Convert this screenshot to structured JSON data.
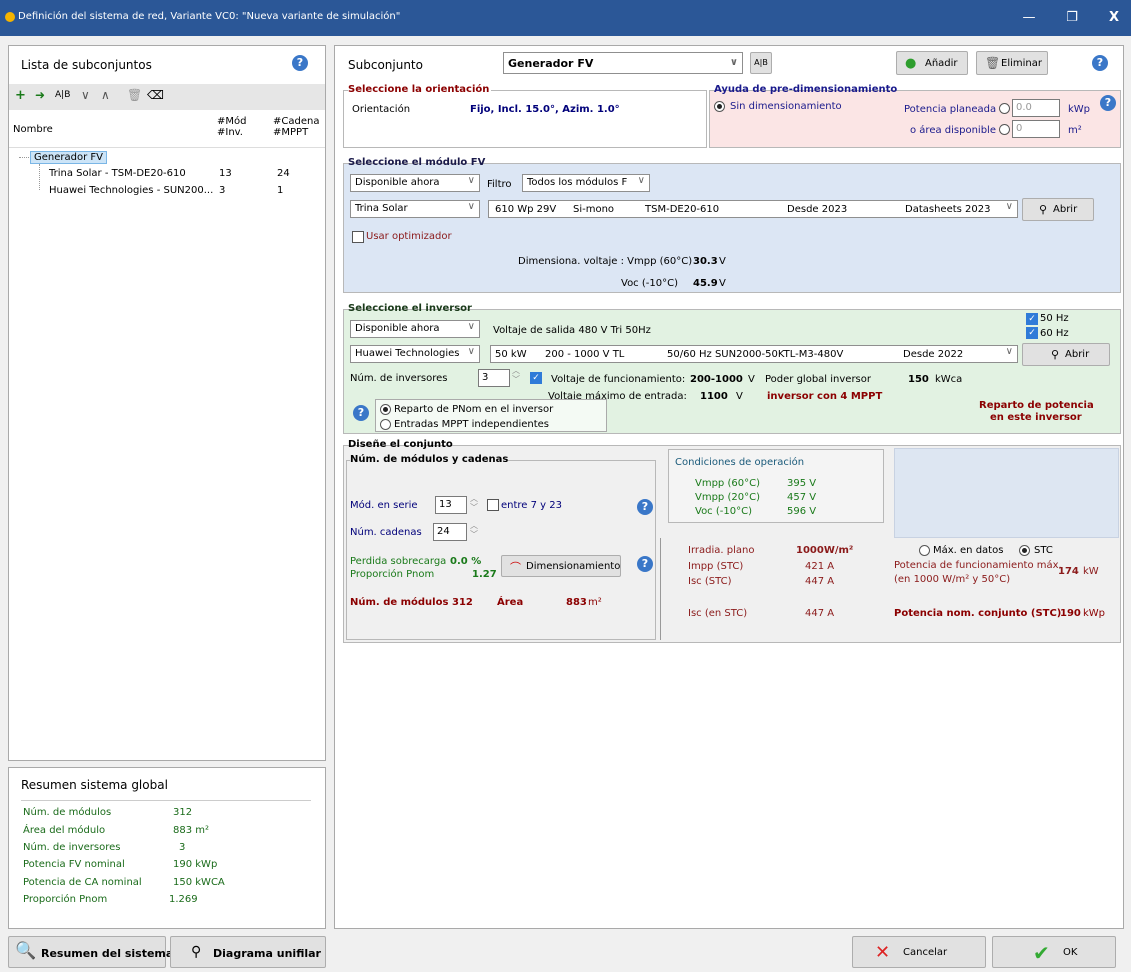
{
  "window": {
    "title": "Definición del sistema de red, Variante VC0:  \"Nueva variante de simulación\"",
    "minimize": "—",
    "restore": "❐",
    "close": "X"
  },
  "left": {
    "title": "Lista de subconjuntos",
    "help": "?",
    "col_nombre": "Nombre",
    "col_mod": "#Mód\n#Inv.",
    "col_mod1": "#Mód",
    "col_mod2": "#Inv.",
    "col_cad1": "#Cadena",
    "col_cad2": "#MPPT",
    "tree": {
      "root": "Generador FV",
      "child1": {
        "name": "Trina Solar - TSM-DE20-610",
        "a": "13",
        "b": "24"
      },
      "child2": {
        "name": "Huawei Technologies - SUN200...",
        "a": "3",
        "b": "1"
      }
    }
  },
  "summary": {
    "title": "Resumen sistema global",
    "rows": [
      {
        "label": "Núm. de módulos",
        "value": "312"
      },
      {
        "label": "Área del módulo",
        "value": "883 m²"
      },
      {
        "label": "Núm. de inversores",
        "value": "3"
      },
      {
        "label": "Potencia FV nominal",
        "value": "190  kWp"
      },
      {
        "label": "Potencia de CA nominal",
        "value": "150  kWCA"
      },
      {
        "label": "Proporción Pnom",
        "value": "1.269"
      }
    ]
  },
  "bottom_left": {
    "resumen": "Resumen del sistema",
    "diagrama": "Diagrama unifilar"
  },
  "top": {
    "subconjunto_label": "Subconjunto",
    "subconjunto_value": "Generador FV",
    "anadir": "Añadir",
    "eliminar": "Eliminar"
  },
  "orient": {
    "title": "Seleccione la orientación",
    "label": "Orientación",
    "value": "Fijo, Incl. 15.0°, Azim. 1.0°"
  },
  "predim": {
    "title": "Ayuda de pre-dimensionamiento",
    "sin": "Sin dimensionamiento",
    "potencia": "Potencia planeada",
    "pot_val": "0.0",
    "pot_unit": "kWp",
    "area": "o área disponible",
    "area_val": "0",
    "area_unit": "m²"
  },
  "module": {
    "title": "Seleccione el módulo FV",
    "disp": "Disponible ahora",
    "filtro": "Filtro",
    "todos": "Todos los módulos F",
    "maker": "Trina Solar",
    "spec1": "610 Wp 29V",
    "spec2": "Si-mono",
    "spec3": "TSM-DE20-610",
    "spec4": "Desde 2023",
    "spec5": "Datasheets 2023",
    "abrir": "Abrir",
    "optim": "Usar optimizador",
    "dim_label": "Dimensiona. voltaje :  Vmpp (60°C)",
    "dim_val": "30.3",
    "dim_unit": "V",
    "voc_label": "Voc (-10°C)",
    "voc_val": "45.9",
    "voc_unit": "V"
  },
  "inverter": {
    "title": "Seleccione el inversor",
    "disp": "Disponible ahora",
    "voltaje": "Voltaje de salida 480 V Tri 50Hz",
    "hz50": "50 Hz",
    "hz60": "60 Hz",
    "maker": "Huawei Technologies",
    "s1": "50 kW",
    "s2": "200 - 1000 V  TL",
    "s3": "50/60 Hz  SUN2000-50KTL-M3-480V",
    "s4": "Desde 2022",
    "abrir": "Abrir",
    "num_label": "Núm. de inversores",
    "num_val": "3",
    "vfunc": "Voltaje de funcionamiento:",
    "vfunc_val": "200-1000",
    "v_unit": "V",
    "poder": "Poder global inversor",
    "poder_val": "150",
    "poder_unit": "kWca",
    "vmax": "Voltaje máximo de entrada:",
    "vmax_val": "1100",
    "vmax_unit": "V",
    "mppt": "inversor con 4 MPPT",
    "opt1": "Reparto de PNom en el inversor",
    "opt2": "Entradas MPPT independientes",
    "reparto1": "Reparto de potencia",
    "reparto2": "en este inversor"
  },
  "array": {
    "title": "Diseñe el conjunto",
    "sub": "Núm. de módulos y cadenas",
    "serie_label": "Mód. en serie",
    "serie_val": "13",
    "entre": "entre 7 y 23",
    "cad_label": "Núm. cadenas",
    "cad_val": "24",
    "perd_label": "Perdida sobrecarga",
    "perd_val": "0.0 %",
    "prop_label": "Proporción Pnom",
    "prop_val": "1.27",
    "dimens": "Dimensionamiento",
    "nmod_label": "Núm. de módulos",
    "nmod_val": "312",
    "area_label": "Área",
    "area_val": "883",
    "area_unit": "m²",
    "cond_title": "Condiciones de operación",
    "c1l": "Vmpp (60°C)",
    "c1v": "395  V",
    "c2l": "Vmpp (20°C)",
    "c2v": "457  V",
    "c3l": "Voc (-10°C)",
    "c3v": "596  V",
    "irr_label": "Irradia. plano",
    "irr_val": "1000W/m²",
    "impp_label": "Impp (STC)",
    "impp_val": "421 A",
    "isc_label": "Isc (STC)",
    "isc_val": "447 A",
    "isc2_label": "Isc (en STC)",
    "isc2_val": "447 A",
    "max_datos": "Máx. en datos",
    "stc": "STC",
    "pot_func": "Potencia de funcionamiento máx.",
    "pot_func2": "(en 1000 W/m²  y 50°C)",
    "pot_func_val": "174",
    "pot_func_unit": "kW",
    "pnom_label": "Potencia nom. conjunto (STC)",
    "pnom_val": "190",
    "pnom_unit": "kWp"
  },
  "footer": {
    "cancelar": "Cancelar",
    "ok": "OK"
  }
}
